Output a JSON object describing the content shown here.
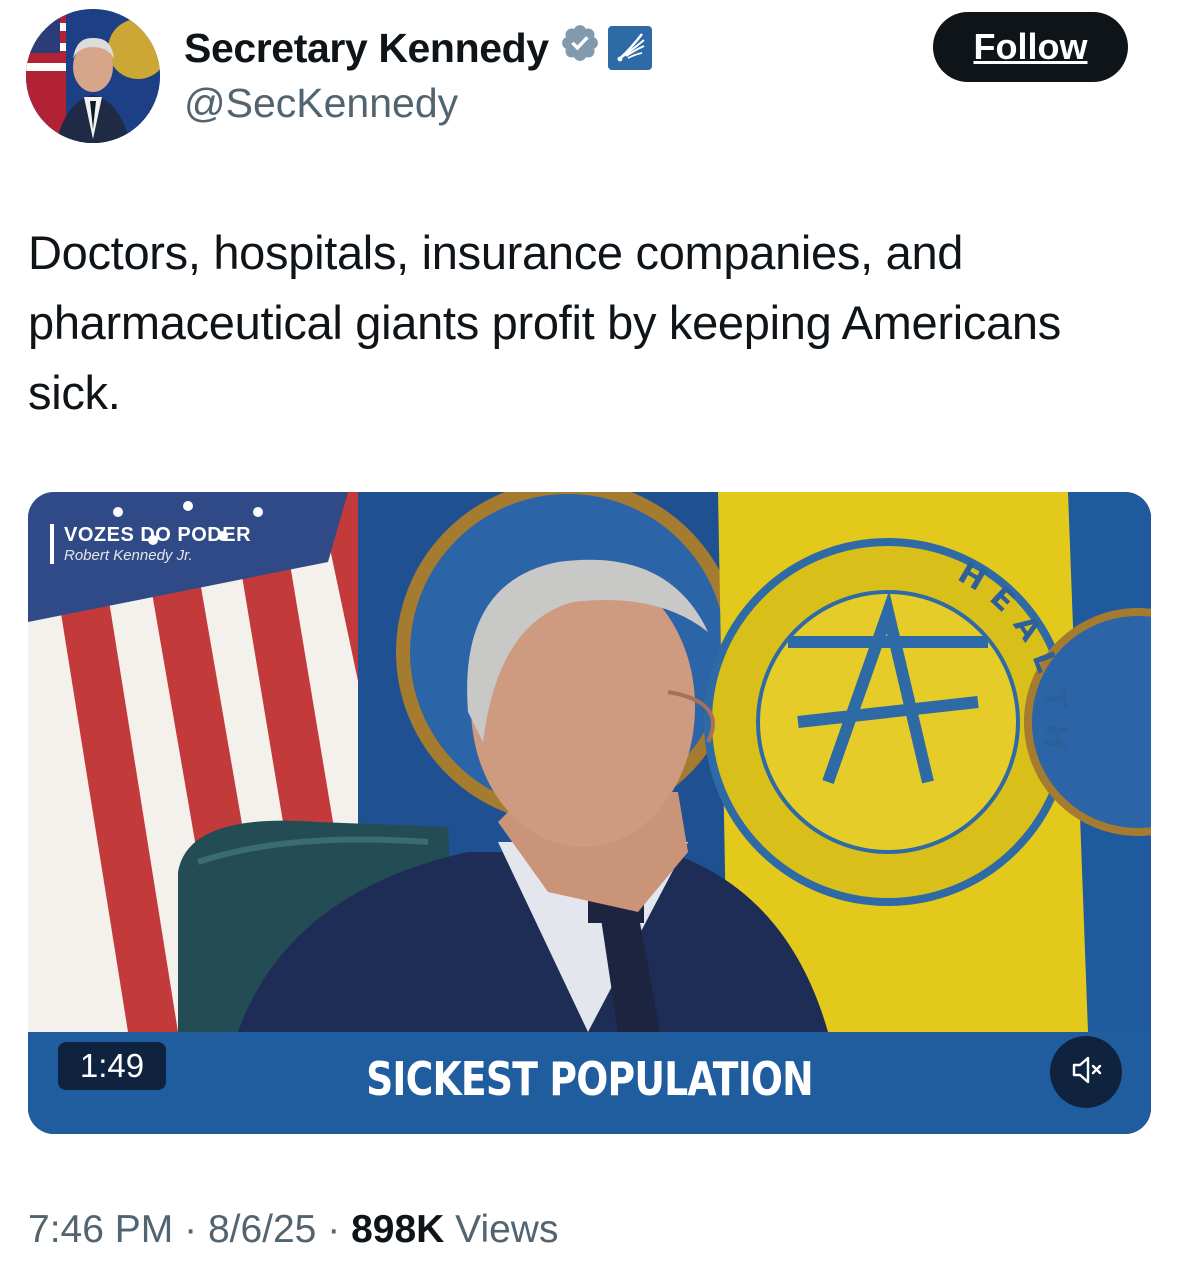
{
  "author": {
    "name": "Secretary Kennedy",
    "handle": "@SecKennedy",
    "follow_label": "Follow"
  },
  "tweet": {
    "text": "Doctors, hospitals, insurance companies, and pharmaceutical giants profit by keeping Americans sick."
  },
  "video": {
    "watermark_title": "VOZES DO PODER",
    "watermark_subtitle": "Robert Kennedy Jr.",
    "caption": "SICKEST POPULATION",
    "duration": "1:49",
    "flag_text": "HEALTH"
  },
  "meta": {
    "time": "7:46 PM",
    "date": "8/6/25",
    "views_count": "898K",
    "views_label": "Views",
    "separator": "·"
  },
  "colors": {
    "verified_badge": "#829aab",
    "follow_bg": "#0f1419",
    "caption_bar": "#1f5d9e",
    "secondary_text": "#536471"
  },
  "icons": {
    "verified": "verified-badge-icon",
    "affiliation": "hhs-eagle-icon",
    "mute": "speaker-muted-icon"
  }
}
